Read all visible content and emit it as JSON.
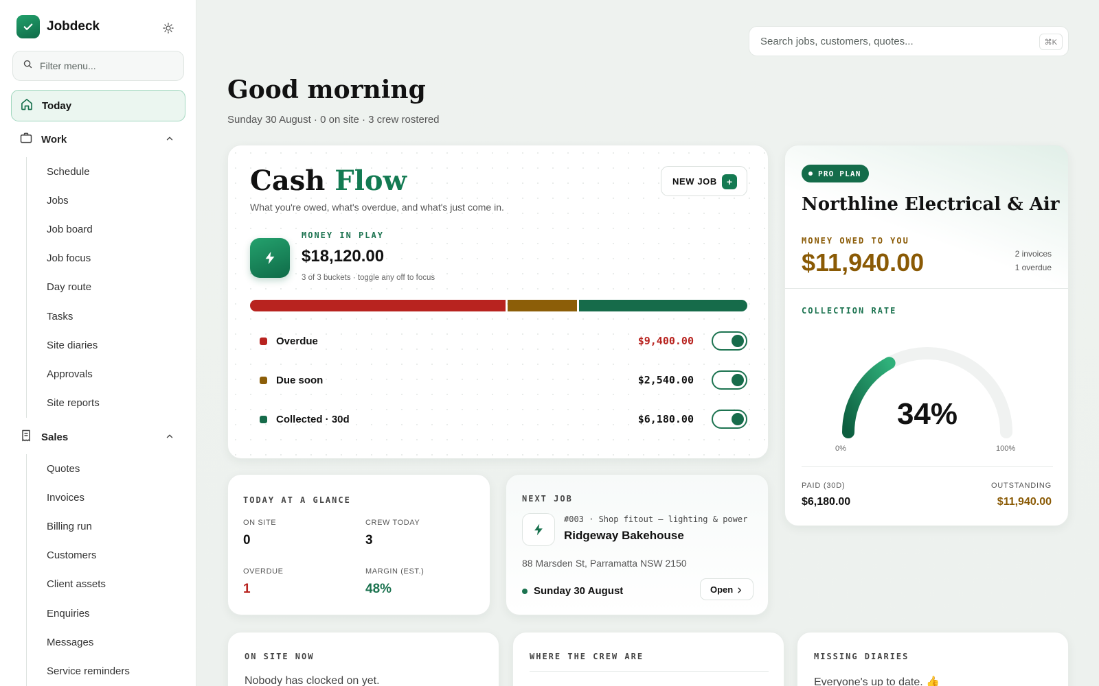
{
  "sidebar": {
    "brand": "Jobdeck",
    "filter_placeholder": "Filter menu...",
    "today_label": "Today",
    "work_label": "Work",
    "work_items": [
      "Schedule",
      "Jobs",
      "Job board",
      "Job focus",
      "Day route",
      "Tasks",
      "Site diaries",
      "Approvals",
      "Site reports"
    ],
    "sales_label": "Sales",
    "sales_items": [
      "Quotes",
      "Invoices",
      "Billing run",
      "Customers",
      "Client assets",
      "Enquiries",
      "Messages",
      "Service reminders"
    ]
  },
  "header": {
    "search_placeholder": "Search jobs, customers, quotes...",
    "search_shortcut": "⌘K",
    "greeting": "Good morning",
    "subline": "Sunday 30 August · 0 on site · 3 crew rostered"
  },
  "cashflow": {
    "title_a": "Cash",
    "title_b": "Flow",
    "subtitle": "What you're owed, what's overdue, and what's just come in.",
    "new_job_label": "NEW JOB",
    "new_job_icon": "+",
    "money_label": "MONEY IN PLAY",
    "money_value": "$18,120.00",
    "money_note": "3 of 3 buckets · toggle any off to focus",
    "buckets": [
      {
        "name": "Overdue",
        "amount": "$9,400.00",
        "value": 9400,
        "color": "#b8231f",
        "enabled": true
      },
      {
        "name": "Due soon",
        "amount": "$2,540.00",
        "value": 2540,
        "color": "#8c5e08",
        "enabled": true
      },
      {
        "name": "Collected · 30d",
        "amount": "$6,180.00",
        "value": 6180,
        "color": "#166b4a",
        "enabled": true
      }
    ]
  },
  "org": {
    "plan_badge": "PRO PLAN",
    "name": "Northline Electrical & Air",
    "owed_label": "MONEY OWED TO YOU",
    "owed_value": "$11,940.00",
    "invoices_note": "2 invoices",
    "overdue_note": "1 overdue",
    "collection_label": "COLLECTION RATE",
    "collection_rate": 0.34,
    "collection_text": "34%",
    "gauge_min": "0%",
    "gauge_max": "100%",
    "paid_label": "PAID (30D)",
    "paid_value": "$6,180.00",
    "outstanding_label": "OUTSTANDING",
    "outstanding_value": "$11,940.00"
  },
  "glance": {
    "title": "TODAY AT A GLANCE",
    "on_site_label": "ON SITE",
    "on_site_value": "0",
    "crew_label": "CREW TODAY",
    "crew_value": "3",
    "overdue_label": "OVERDUE",
    "overdue_value": "1",
    "margin_label": "MARGIN (EST.)",
    "margin_value": "48%"
  },
  "next_job": {
    "title": "NEXT JOB",
    "meta": "#003 · Shop fitout — lighting & power",
    "customer": "Ridgeway Bakehouse",
    "address": "88 Marsden St, Parramatta NSW 2150",
    "date": "Sunday 30 August",
    "open_label": "Open"
  },
  "bottom_cards": {
    "on_site_title": "ON SITE NOW",
    "on_site_text": "Nobody has clocked on yet.",
    "crew_title": "WHERE THE CREW ARE",
    "diaries_title": "MISSING DIARIES",
    "diaries_text": "Everyone's up to date. 👍"
  },
  "colors": {
    "accent": "#147a52",
    "overdue": "#b8231f",
    "due_soon": "#8c5e08",
    "collected": "#166b4a",
    "gold": "#8a5a05"
  },
  "icons": {
    "brand": "check-icon",
    "theme": "sun-icon",
    "filter": "search-icon",
    "today": "home-icon",
    "work": "briefcase-icon",
    "sales": "receipt-icon",
    "money": "bolt-icon"
  }
}
